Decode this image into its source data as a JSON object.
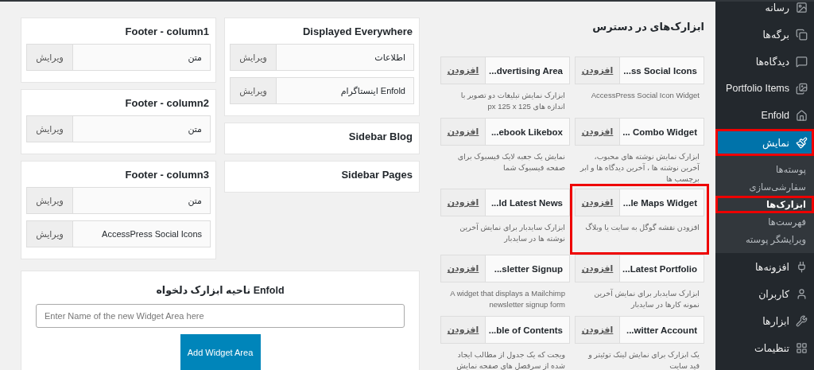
{
  "sidebar": {
    "items": [
      {
        "label": "رسانه",
        "selected": false,
        "highlighted": false
      },
      {
        "label": "برگه‌ها",
        "selected": false,
        "highlighted": false
      },
      {
        "label": "دیدگاه‌ها",
        "selected": false,
        "highlighted": false
      },
      {
        "label": "Portfolio Items",
        "selected": false,
        "highlighted": false
      },
      {
        "label": "Enfold",
        "selected": false,
        "highlighted": false
      },
      {
        "label": "نمایش",
        "selected": true,
        "highlighted": true,
        "children": [
          {
            "label": "پوسته‌ها",
            "selected": false,
            "highlighted": false
          },
          {
            "label": "سفارشی‌سازی",
            "selected": false,
            "highlighted": false
          },
          {
            "label": "ابزارک‌ها",
            "selected": true,
            "highlighted": true
          },
          {
            "label": "فهرست‌ها",
            "selected": false,
            "highlighted": false
          },
          {
            "label": "ویرایشگر پوسته",
            "selected": false,
            "highlighted": false
          }
        ]
      },
      {
        "label": "افزونه‌ها",
        "selected": false,
        "highlighted": false
      },
      {
        "label": "کاربران",
        "selected": false,
        "highlighted": false
      },
      {
        "label": "ابزارها",
        "selected": false,
        "highlighted": false
      },
      {
        "label": "تنظیمات",
        "selected": false,
        "highlighted": false
      }
    ]
  },
  "available_widgets": {
    "title": "ابزارک‌های در دسترس",
    "widgets": [
      {
        "name": "...ss Social Icons",
        "add_label": "افزودن",
        "description": "AccessPress Social Icon Widget",
        "highlighted": false
      },
      {
        "name": "...dvertising Area",
        "add_label": "افزودن",
        "description": "ابزارک نمایش تبلیغات دو تصویر با اندازه های 125 px 125 x",
        "highlighted": false
      },
      {
        "name": "... Combo Widget",
        "add_label": "افزودن",
        "description": "ابزارک نمایش نوشته های محبوب، آخرین نوشته ها ، آخرین دیدگاه ها و ابر برچسب ها",
        "highlighted": false
      },
      {
        "name": "...ebook Likebox",
        "add_label": "افزودن",
        "description": "نمایش یک جعبه لایک فیسبوک برای صفحه فیسبوک شما",
        "highlighted": false
      },
      {
        "name": "...le Maps Widget",
        "add_label": "افزودن",
        "description": "افزودن نقشه گوگل به سایت یا وبلاگ",
        "highlighted": true
      },
      {
        "name": "...ld Latest News",
        "add_label": "افزودن",
        "description": "ابزارک سایدبار برای نمایش آخرین نوشته ها در سایدبار",
        "highlighted": false
      },
      {
        "name": "...Latest Portfolio",
        "add_label": "افزودن",
        "description": "ابزارک سایدبار برای نمایش آخرین نمونه کارها در سایدبار",
        "highlighted": false
      },
      {
        "name": "...sletter Signup",
        "add_label": "افزودن",
        "description": "A widget that displays a Mailchimp newsletter signup form",
        "highlighted": false
      },
      {
        "name": "...witter Account",
        "add_label": "افزودن",
        "description": "یک ابزارک برای نمایش لینک توئیتر و فید سایت",
        "highlighted": false
      },
      {
        "name": "...ble of Contents",
        "add_label": "افزودن",
        "description": "ویجت که یک جدول از مطالب ایجاد شده از سرفصل های صفحه نمایش",
        "highlighted": false
      }
    ]
  },
  "widget_areas": {
    "columns": [
      [
        {
          "title": "Displayed Everywhere",
          "widgets": [
            {
              "name": "اطلاعات",
              "edit_label": "ویرایش"
            },
            {
              "name": "Enfold اینستاگرام",
              "edit_label": "ویرایش"
            }
          ]
        },
        {
          "title": "Sidebar Blog"
        },
        {
          "title": "Sidebar Pages"
        }
      ],
      [
        {
          "title": "Footer - column1",
          "widgets": [
            {
              "name": "متن",
              "edit_label": "ویرایش"
            }
          ]
        },
        {
          "title": "Footer - column2",
          "widgets": [
            {
              "name": "متن",
              "edit_label": "ویرایش"
            }
          ]
        },
        {
          "title": "Footer - column3",
          "widgets": [
            {
              "name": "متن",
              "edit_label": "ویرایش"
            },
            {
              "name": "AccessPress Social Icons",
              "edit_label": "ویرایش"
            }
          ]
        }
      ]
    ]
  },
  "custom_area": {
    "title": "Enfold ناحیه ابزارک دلخواه",
    "placeholder": "Enter Name of the new Widget Area here",
    "button": "Add Widget Area"
  }
}
